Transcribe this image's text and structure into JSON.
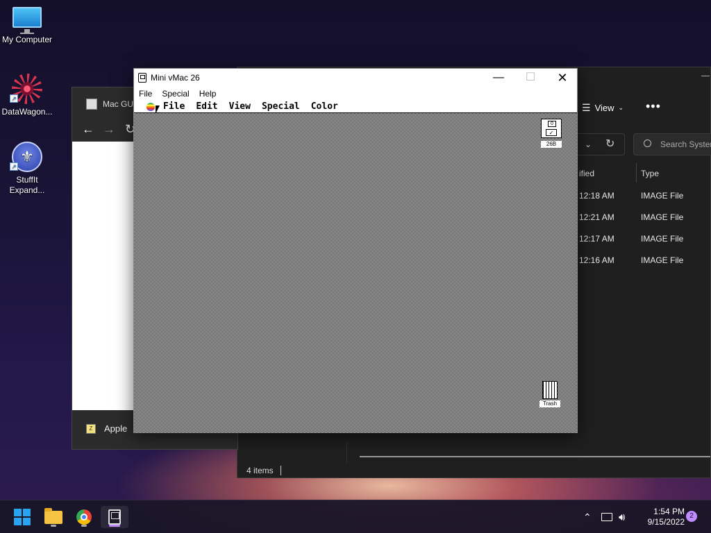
{
  "desktop": {
    "icons": [
      {
        "label": "My Computer"
      },
      {
        "label": "DataWagon..."
      },
      {
        "label": "StuffIt Expand..."
      }
    ]
  },
  "browser": {
    "tab_title": "Mac GU",
    "download_label": "Apple"
  },
  "explorer": {
    "view_label": "View",
    "more_label": "•••",
    "search_placeholder": "Search System",
    "columns": {
      "modified": "ified",
      "type": "Type"
    },
    "rows": [
      {
        "time": "12:18 AM",
        "type": "IMAGE File"
      },
      {
        "time": "12:21 AM",
        "type": "IMAGE File"
      },
      {
        "time": "12:17 AM",
        "type": "IMAGE File"
      },
      {
        "time": "12:16 AM",
        "type": "IMAGE File"
      }
    ],
    "status": "4 items"
  },
  "vmac": {
    "title": "Mini vMac 26",
    "host_menu": [
      "File",
      "Special",
      "Help"
    ],
    "mac_menu": [
      "File",
      "Edit",
      "View",
      "Special",
      "Color"
    ],
    "disk_label": "0",
    "disk_check": "✓",
    "disk_name": "26B",
    "trash_name": "Trash"
  },
  "taskbar": {
    "time": "1:54 PM",
    "date": "9/15/2022",
    "notification_count": "2"
  }
}
